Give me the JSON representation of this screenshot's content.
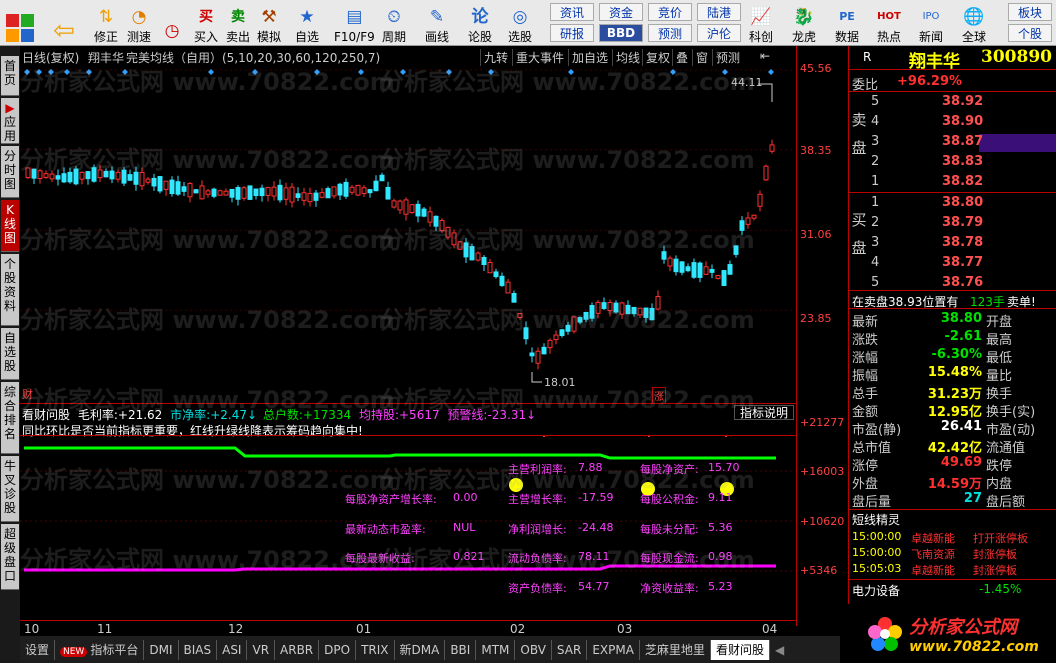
{
  "toolbar": {
    "buttons": [
      "修正",
      "测速",
      "买入",
      "卖出",
      "模拟",
      "自选",
      "F10/F9",
      "周期",
      "画线",
      "论股",
      "选股",
      "科创",
      "龙虎",
      "数据",
      "热点",
      "新闻",
      "全球"
    ],
    "small": [
      "资讯",
      "资金",
      "竞价",
      "陆港",
      "研报",
      "BBD",
      "预测",
      "沪伦",
      "板块",
      "个股"
    ]
  },
  "leftbar": [
    "首页",
    "应用",
    "分时图",
    "K线图",
    "个股资料",
    "自选股",
    "综合排名",
    "牛叉诊股",
    "超级盘口"
  ],
  "chart_header": {
    "title": "日线(复权)",
    "stock": "翔丰华",
    "ma_label": "完美均线（自用）(5,10,20,30,60,120,250,7)",
    "buttons": [
      "九转",
      "重大事件",
      "加自选",
      "均线",
      "复权",
      "叠",
      "窗",
      "预测"
    ]
  },
  "price_axis": [
    "45.56",
    "38.35",
    "31.06",
    "23.85"
  ],
  "price_labels": {
    "high": "44.11",
    "low": "18.01",
    "cai": "财",
    "zhang": "涨"
  },
  "indicator_header": {
    "name": "看财问股",
    "mll_label": "毛利率:",
    "mll": "+21.62",
    "sjl_label": "市净率:",
    "sjl": "+2.47↓",
    "zhs_label": "总户数:",
    "zhs": "+17334",
    "jcg_label": "均持股:",
    "jcg": "+5617",
    "yjx_label": "预警线:",
    "yjx": "-23.31↓",
    "note": "同比环比是否当前指标更重要，红线升绿线降表示筹码趋向集中!",
    "explain": "指标说明"
  },
  "indicator_axis": [
    "+21277",
    "+16003",
    "+10620",
    "+5346"
  ],
  "fundamentals": [
    {
      "label": "主营利润率:",
      "value": "7.88"
    },
    {
      "label": "每股净资产:",
      "value": "15.70"
    },
    {
      "label": "每股净资产增长率:",
      "value": "0.00"
    },
    {
      "label": "主营增长率:",
      "value": "-17.59"
    },
    {
      "label": "每股公积金:",
      "value": "9.11"
    },
    {
      "label": "最新动态市盈率:",
      "value": "NUL"
    },
    {
      "label": "净利润增长:",
      "value": "-24.48"
    },
    {
      "label": "每股未分配:",
      "value": "5.36"
    },
    {
      "label": "每股最新收益:",
      "value": "0.821"
    },
    {
      "label": "流动负债率:",
      "value": "78.11"
    },
    {
      "label": "每股现金流:",
      "value": "0.98"
    },
    {
      "label": "资产负债率:",
      "value": "54.77"
    },
    {
      "label": "净资收益率:",
      "value": "5.23"
    }
  ],
  "time_axis": [
    "10",
    "11",
    "12",
    "01",
    "02",
    "03",
    "04"
  ],
  "tabs": [
    "设置",
    "NEW",
    "指标平台",
    "DMI",
    "BIAS",
    "ASI",
    "VR",
    "ARBR",
    "DPO",
    "TRIX",
    "新DMA",
    "BBI",
    "MTM",
    "OBV",
    "SAR",
    "EXPMA",
    "芝麻里地里",
    "看财问股"
  ],
  "panel": {
    "stock_name": "翔丰华",
    "stock_code": "300890",
    "r": "R",
    "weibi_label": "委比",
    "weibi": "+96.29%",
    "sell_side": "卖盘",
    "buy_side": "买盘",
    "sell": [
      {
        "n": "5",
        "p": "38.92"
      },
      {
        "n": "4",
        "p": "38.90"
      },
      {
        "n": "3",
        "p": "38.87"
      },
      {
        "n": "2",
        "p": "38.83"
      },
      {
        "n": "1",
        "p": "38.82"
      }
    ],
    "buy": [
      {
        "n": "1",
        "p": "38.80"
      },
      {
        "n": "2",
        "p": "38.79"
      },
      {
        "n": "3",
        "p": "38.78"
      },
      {
        "n": "4",
        "p": "38.77"
      },
      {
        "n": "5",
        "p": "38.76"
      }
    ],
    "pos_text": "在卖盘38.93位置有",
    "pos_qty": "123手",
    "pos_tag": "卖单!",
    "stats": [
      {
        "l": "最新",
        "v": "38.80",
        "r": "开盘",
        "c": "grn"
      },
      {
        "l": "涨跌",
        "v": "-2.61",
        "r": "最高",
        "c": "grn"
      },
      {
        "l": "涨幅",
        "v": "-6.30%",
        "r": "最低",
        "c": "grn"
      },
      {
        "l": "振幅",
        "v": "15.48%",
        "r": "量比",
        "c": "yel"
      },
      {
        "l": "总手",
        "v": "31.23万",
        "r": "换手",
        "c": "yel"
      },
      {
        "l": "金额",
        "v": "12.95亿",
        "r": "换手(实)",
        "c": "yel"
      },
      {
        "l": "市盈(静)",
        "v": "26.41",
        "r": "市盈(动)",
        "c": "wh"
      },
      {
        "l": "总市值",
        "v": "42.42亿",
        "r": "流通值",
        "c": "yel"
      },
      {
        "l": "涨停",
        "v": "49.69",
        "r": "跌停",
        "c": "red"
      },
      {
        "l": "外盘",
        "v": "14.59万",
        "r": "内盘",
        "c": "red"
      },
      {
        "l": "盘后量",
        "v": "27",
        "r": "盘后额",
        "c": "cy"
      }
    ],
    "alerts_title": "短线精灵",
    "alerts": [
      {
        "t": "15:00:00",
        "n": "卓越新能",
        "a": "打开涨停板"
      },
      {
        "t": "15:00:00",
        "n": "飞南资源",
        "a": "封涨停板"
      },
      {
        "t": "15:05:03",
        "n": "卓越新能",
        "a": "封涨停板"
      }
    ],
    "sector": "电力设备",
    "sector_chg": "-1.45%"
  },
  "logo": {
    "name": "分析家公式网",
    "url": "www.70822.com"
  },
  "watermark": "分析家公式网 www.70822.com"
}
